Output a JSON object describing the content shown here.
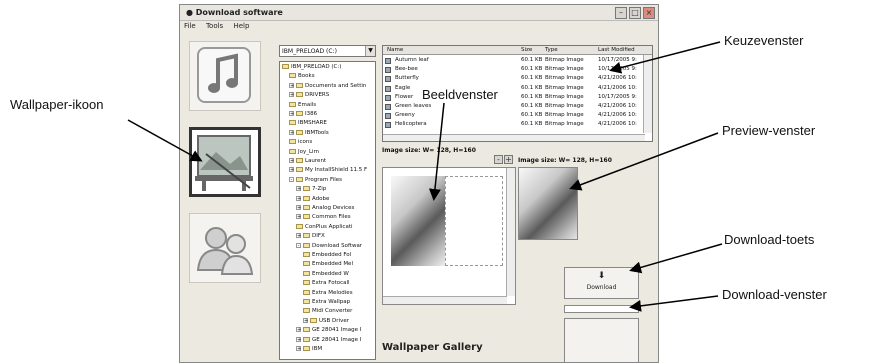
{
  "window": {
    "title": "Download software",
    "menu": [
      "File",
      "Tools",
      "Help"
    ],
    "controls": [
      "minimize",
      "maximize",
      "close"
    ]
  },
  "sidebar": {
    "buttons": [
      {
        "name": "ringtone",
        "icon": "music-note-icon",
        "selected": false
      },
      {
        "name": "wallpaper",
        "icon": "wallpaper-icon",
        "selected": true
      },
      {
        "name": "contacts",
        "icon": "people-icon",
        "selected": false
      }
    ]
  },
  "drive_combo": {
    "value": "IBM_PRELOAD (C:)"
  },
  "tree": [
    {
      "label": "IBM_PRELOAD (C:)",
      "depth": 0,
      "expanded": true
    },
    {
      "label": "Books",
      "depth": 1
    },
    {
      "label": "Documents and Settin",
      "depth": 1,
      "pm": "+"
    },
    {
      "label": "DRIVERS",
      "depth": 1,
      "pm": "+"
    },
    {
      "label": "Emails",
      "depth": 1
    },
    {
      "label": "I386",
      "depth": 1,
      "pm": "+"
    },
    {
      "label": "IBMSHARE",
      "depth": 1
    },
    {
      "label": "IBMTools",
      "depth": 1,
      "pm": "+"
    },
    {
      "label": "icons",
      "depth": 1
    },
    {
      "label": "Joy_Lim",
      "depth": 1
    },
    {
      "label": "Laurent",
      "depth": 1,
      "pm": "+"
    },
    {
      "label": "My InstallShield 11.5 F",
      "depth": 1,
      "pm": "+"
    },
    {
      "label": "Program Files",
      "depth": 1,
      "pm": "-"
    },
    {
      "label": "7-Zip",
      "depth": 2,
      "pm": "+"
    },
    {
      "label": "Adobe",
      "depth": 2,
      "pm": "+"
    },
    {
      "label": "Analog Devices",
      "depth": 2,
      "pm": "+"
    },
    {
      "label": "Common Files",
      "depth": 2,
      "pm": "+"
    },
    {
      "label": "ConPlus Applicati",
      "depth": 2
    },
    {
      "label": "DIFX",
      "depth": 2,
      "pm": "+"
    },
    {
      "label": "Download Softwar",
      "depth": 2,
      "pm": "-"
    },
    {
      "label": "Embedded Fol",
      "depth": 3
    },
    {
      "label": "Embedded Mel",
      "depth": 3
    },
    {
      "label": "Embedded W",
      "depth": 3
    },
    {
      "label": "Extra Fotocall",
      "depth": 3
    },
    {
      "label": "Extra Melodies",
      "depth": 3
    },
    {
      "label": "Extra Wallpap",
      "depth": 3
    },
    {
      "label": "Midi Converter",
      "depth": 3
    },
    {
      "label": "USB Driver",
      "depth": 3,
      "pm": "+"
    },
    {
      "label": "GE 28041 Image I",
      "depth": 2,
      "pm": "+"
    },
    {
      "label": "GE 28041 Image I",
      "depth": 2,
      "pm": "+"
    },
    {
      "label": "IBM",
      "depth": 2,
      "pm": "+"
    }
  ],
  "file_list": {
    "headers": [
      "Name",
      "Size",
      "Type",
      "Last Modified"
    ],
    "rows": [
      [
        "Autumn leaf",
        "60.1 KB",
        "Bitmap Image",
        "10/17/2005 9:"
      ],
      [
        "Bee-bee",
        "60.1 KB",
        "Bitmap Image",
        "10/17/2005 9:"
      ],
      [
        "Butterfly",
        "60.1 KB",
        "Bitmap Image",
        "4/21/2006 10:"
      ],
      [
        "Eagle",
        "60.1 KB",
        "Bitmap Image",
        "4/21/2006 10:"
      ],
      [
        "Flower",
        "60.1 KB",
        "Bitmap Image",
        "10/17/2005 9:"
      ],
      [
        "Green leaves",
        "60.1 KB",
        "Bitmap Image",
        "4/21/2006 10:"
      ],
      [
        "Greeny",
        "60.1 KB",
        "Bitmap Image",
        "4/21/2006 10:"
      ],
      [
        "Helicoptera",
        "60.1 KB",
        "Bitmap Image",
        "4/21/2006 10:"
      ]
    ]
  },
  "image_size_left": "Image size: W= 128, H=160",
  "image_size_right": "Image size: W= 128, H=160",
  "zoom_buttons": [
    "-",
    "+"
  ],
  "download_button": {
    "label": "Download",
    "icon": "download-arrow-icon"
  },
  "gallery_title": "Wallpaper Gallery",
  "callouts": {
    "keuze": "Keuzevenster",
    "wallpaper": "Wallpaper-ikoon",
    "beeld": "Beeldvenster",
    "preview": "Preview-venster",
    "download_toets": "Download-toets",
    "download_venster": "Download-venster"
  }
}
